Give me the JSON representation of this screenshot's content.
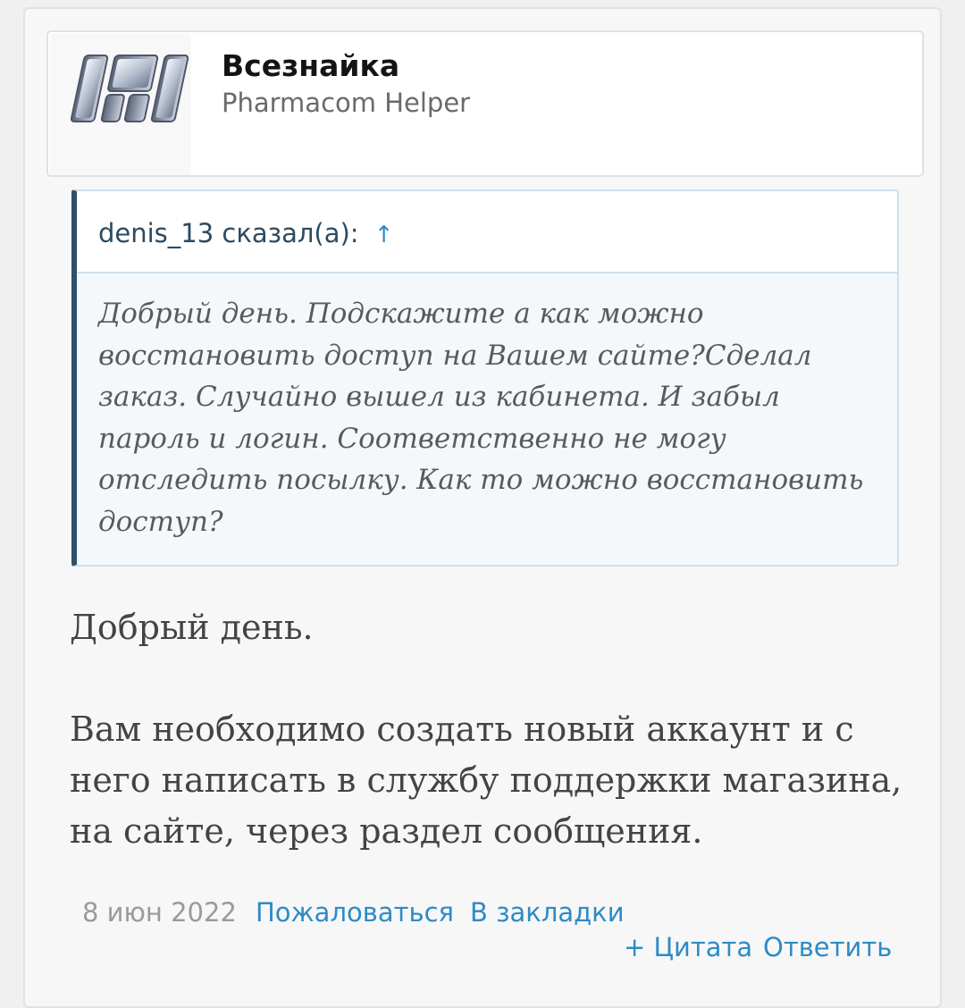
{
  "author": {
    "name": "Всезнайка",
    "title": "Pharmacom Helper",
    "avatar_icon": "pharmacom-logo"
  },
  "quote": {
    "author_line": "denis_13 сказал(а):",
    "jump_icon": "↑",
    "text": "Добрый день. Подскажите а как можно восстановить доступ на Вашем сайте?Сделал заказ. Случайно вышел из кабинета. И забыл пароль и логин. Соответственно не могу отследить посылку. Как то можно восстановить доступ?"
  },
  "reply": {
    "greeting": "Добрый день.",
    "body": "Вам необходимо создать новый аккаунт и с него написать в службу поддержки магазина, на сайте, через раздел сообщения."
  },
  "footer": {
    "date": "8 июн 2022",
    "report_label": "Пожаловаться",
    "bookmark_label": "В закладки",
    "quote_label": "+ Цитата",
    "reply_label": "Ответить"
  },
  "colors": {
    "link": "#2d8bc7",
    "quote_border": "#2f5069",
    "quote_bg": "#f4f8fb",
    "text": "#444444"
  }
}
